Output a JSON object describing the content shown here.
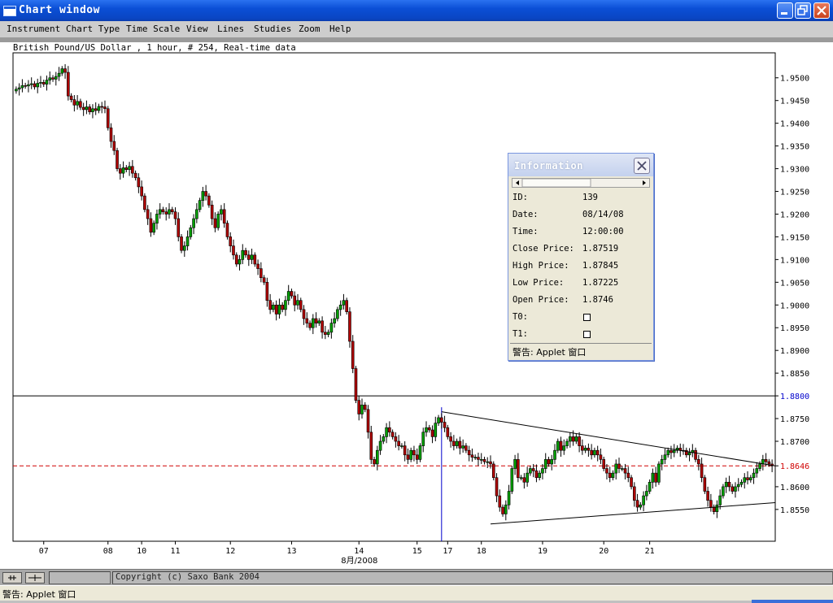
{
  "window": {
    "title": "Chart window",
    "icons": [
      "app-window-icon",
      "minimize-icon",
      "maximize-icon",
      "close-icon"
    ]
  },
  "menu": {
    "items": [
      "Instrument",
      "Chart Type",
      "Time Scale",
      "View",
      "Lines",
      "Studies",
      "Zoom",
      "Help"
    ]
  },
  "chart_header": "British Pound/US Dollar , 1 hour, # 254, Real-time data",
  "chart_data": {
    "type": "candlestick",
    "instrument": "British Pound/US Dollar",
    "interval": "1 hour",
    "ylim": [
      1.848,
      1.9555
    ],
    "y_ticks": [
      "1.9500",
      "1.9450",
      "1.9400",
      "1.9350",
      "1.9300",
      "1.9250",
      "1.9200",
      "1.9150",
      "1.9100",
      "1.9050",
      "1.9000",
      "1.8950",
      "1.8900",
      "1.8850",
      "1.8800",
      "1.8750",
      "1.8700",
      "1.8646",
      "1.8600",
      "1.8550"
    ],
    "y_tick_values": [
      1.95,
      1.945,
      1.94,
      1.935,
      1.93,
      1.925,
      1.92,
      1.915,
      1.91,
      1.905,
      1.9,
      1.895,
      1.89,
      1.885,
      1.88,
      1.875,
      1.87,
      1.8646,
      1.86,
      1.855
    ],
    "x_ticks": [
      "07",
      "08",
      "10",
      "11",
      "12",
      "13",
      "14",
      "15",
      "17",
      "18",
      "19",
      "20",
      "21"
    ],
    "x_month_label": "8月/2008",
    "current_price": 1.8646,
    "crosshair_price": 1.88,
    "up_color": "#00a000",
    "down_color": "#b00000",
    "grid": false,
    "trendlines": [
      {
        "from": [
          139,
          1.8765
        ],
        "to": [
          254,
          1.8646
        ]
      },
      {
        "from": [
          155,
          1.8518
        ],
        "to": [
          254,
          1.8565
        ]
      }
    ],
    "closes": [
      1.9475,
      1.9478,
      1.9483,
      1.9482,
      1.9485,
      1.9487,
      1.948,
      1.9488,
      1.949,
      1.9486,
      1.9495,
      1.95,
      1.9497,
      1.9503,
      1.951,
      1.952,
      1.9512,
      1.946,
      1.9452,
      1.944,
      1.9448,
      1.9435,
      1.943,
      1.9436,
      1.9425,
      1.9432,
      1.9428,
      1.9437,
      1.9436,
      1.9432,
      1.939,
      1.936,
      1.934,
      1.93,
      1.929,
      1.9302,
      1.9298,
      1.9305,
      1.929,
      1.928,
      1.926,
      1.924,
      1.921,
      1.919,
      1.916,
      1.918,
      1.92,
      1.921,
      1.9205,
      1.92,
      1.921,
      1.9205,
      1.919,
      1.915,
      1.912,
      1.913,
      1.915,
      1.917,
      1.919,
      1.921,
      1.923,
      1.925,
      1.924,
      1.922,
      1.919,
      1.917,
      1.92,
      1.921,
      1.918,
      1.915,
      1.913,
      1.911,
      1.909,
      1.91,
      1.912,
      1.911,
      1.91,
      1.911,
      1.909,
      1.908,
      1.906,
      1.905,
      1.901,
      1.899,
      1.9,
      1.898,
      1.9,
      1.899,
      1.901,
      1.903,
      1.902,
      1.9,
      1.901,
      1.899,
      1.897,
      1.896,
      1.895,
      1.897,
      1.896,
      1.8965,
      1.894,
      1.8935,
      1.894,
      1.896,
      1.897,
      1.899,
      1.9,
      1.901,
      1.8985,
      1.892,
      1.886,
      1.879,
      1.876,
      1.878,
      1.877,
      1.872,
      1.866,
      1.865,
      1.868,
      1.87,
      1.871,
      1.873,
      1.872,
      1.871,
      1.87,
      1.869,
      1.869,
      1.867,
      1.866,
      1.868,
      1.867,
      1.866,
      1.869,
      1.872,
      1.873,
      1.8725,
      1.871,
      1.874,
      1.8752,
      1.8742,
      1.873,
      1.871,
      1.87,
      1.869,
      1.87,
      1.8685,
      1.869,
      1.868,
      1.867,
      1.8665,
      1.8665,
      1.866,
      1.866,
      1.8655,
      1.8655,
      1.865,
      1.862,
      1.858,
      1.8555,
      1.854,
      1.856,
      1.859,
      1.864,
      1.866,
      1.862,
      1.862,
      1.861,
      1.863,
      1.864,
      1.8635,
      1.862,
      1.863,
      1.864,
      1.866,
      1.865,
      1.866,
      1.868,
      1.87,
      1.868,
      1.869,
      1.87,
      1.871,
      1.87,
      1.871,
      1.869,
      1.868,
      1.8685,
      1.868,
      1.867,
      1.868,
      1.867,
      1.866,
      1.864,
      1.863,
      1.862,
      1.863,
      1.865,
      1.864,
      1.864,
      1.863,
      1.862,
      1.86,
      1.857,
      1.8555,
      1.856,
      1.858,
      1.859,
      1.861,
      1.863,
      1.861,
      1.865,
      1.866,
      1.867,
      1.868,
      1.8675,
      1.868,
      1.8685,
      1.868,
      1.868,
      1.867,
      1.8675,
      1.868,
      1.866,
      1.865,
      1.862,
      1.859,
      1.857,
      1.8555,
      1.8545,
      1.856,
      1.858,
      1.86,
      1.861,
      1.86,
      1.859,
      1.86,
      1.8605,
      1.861,
      1.862,
      1.8615,
      1.862,
      1.863,
      1.864,
      1.865,
      1.866,
      1.8655,
      1.865,
      1.8646
    ]
  },
  "info_window": {
    "title": "Information",
    "rows": [
      {
        "label": "ID:",
        "value": "139"
      },
      {
        "label": "Date:",
        "value": "08/14/08"
      },
      {
        "label": "Time:",
        "value": "12:00:00"
      },
      {
        "label": "Close Price:",
        "value": "1.87519"
      },
      {
        "label": "High Price:",
        "value": "1.87845"
      },
      {
        "label": "Low Price:",
        "value": "1.87225"
      },
      {
        "label": "Open Price:",
        "value": "1.8746"
      },
      {
        "label": "T0:",
        "value": ""
      },
      {
        "label": "T1:",
        "value": ""
      }
    ],
    "status": "警告: Applet 窗口"
  },
  "bottom_bar": {
    "tool1_icon": "pin-icon",
    "tool2_icon": "crosshair-line-icon",
    "copyright": "Copyright (c) Saxo Bank 2004"
  },
  "status_line": "警告: Applet 窗口"
}
